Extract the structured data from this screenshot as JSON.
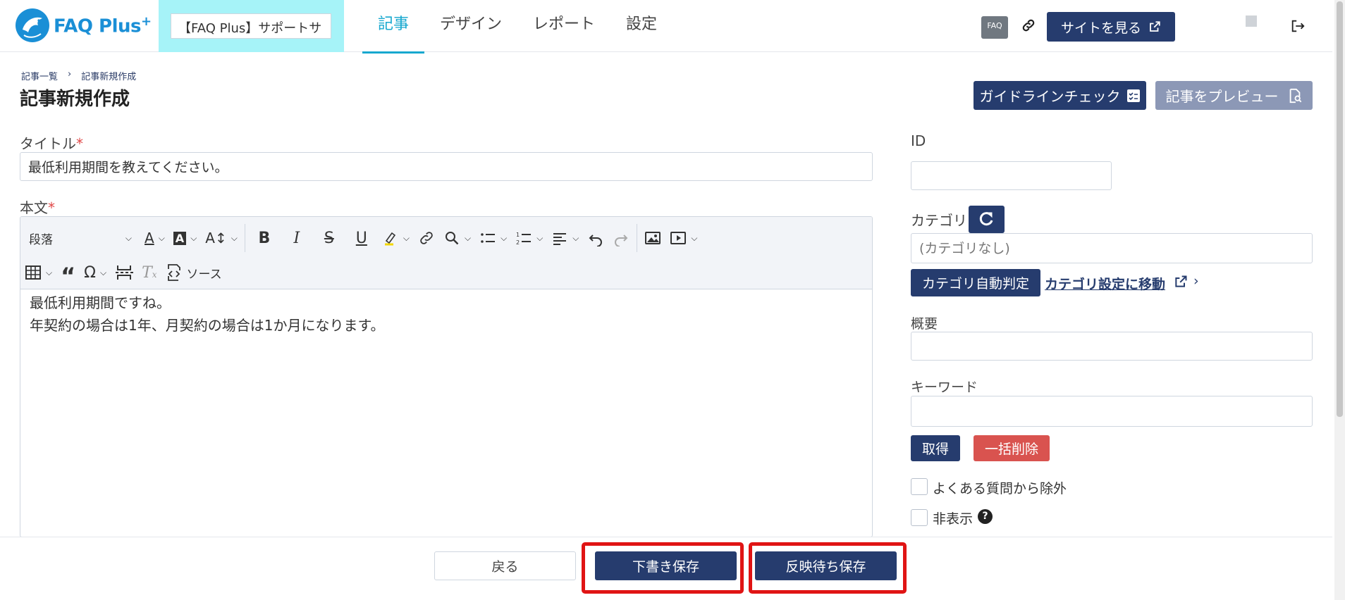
{
  "header": {
    "logo_text": "FAQ Plus",
    "logo_sup": "+",
    "site_select_value": "【FAQ Plus】サポートサ",
    "nav": [
      {
        "label": "記事"
      },
      {
        "label": "デザイン"
      },
      {
        "label": "レポート"
      },
      {
        "label": "設定"
      }
    ],
    "faq_badge": "FAQ",
    "view_site_label": "サイトを見る"
  },
  "breadcrumb": {
    "items": [
      "記事一覧",
      "記事新規作成"
    ],
    "separator": "›"
  },
  "page_title": "記事新規作成",
  "actions": {
    "guideline_check_label": "ガイドラインチェック",
    "preview_label": "記事をプレビュー"
  },
  "form": {
    "title_label": "タイトル",
    "required_mark": "*",
    "title_value": "最低利用期間を教えてください。",
    "body_label": "本文",
    "toolbar": {
      "heading_select": "段落",
      "source_label": "ソース"
    },
    "body_lines": [
      "最低利用期間ですね。",
      "年契約の場合は1年、月契約の場合は1か月になります。"
    ]
  },
  "sidebar": {
    "id_label": "ID",
    "id_value": "",
    "category_label": "カテゴリ",
    "category_placeholder": "(カテゴリなし)",
    "auto_category_label": "カテゴリ自動判定",
    "category_settings_link": "カテゴリ設定に移動",
    "link_suffix": "›",
    "summary_label": "概要",
    "summary_value": "",
    "keyword_label": "キーワード",
    "keyword_value": "",
    "fetch_label": "取得",
    "bulk_delete_label": "一括削除",
    "exclude_faq_label": "よくある質問から除外",
    "hidden_label": "非表示",
    "help_glyph": "?"
  },
  "footer": {
    "back_label": "戻る",
    "draft_save_label": "下書き保存",
    "pending_save_label": "反映待ち保存"
  },
  "colors": {
    "primary": "#263c6e",
    "accent": "#17a8cf",
    "danger": "#d9534f",
    "highlight": "#e01414"
  }
}
